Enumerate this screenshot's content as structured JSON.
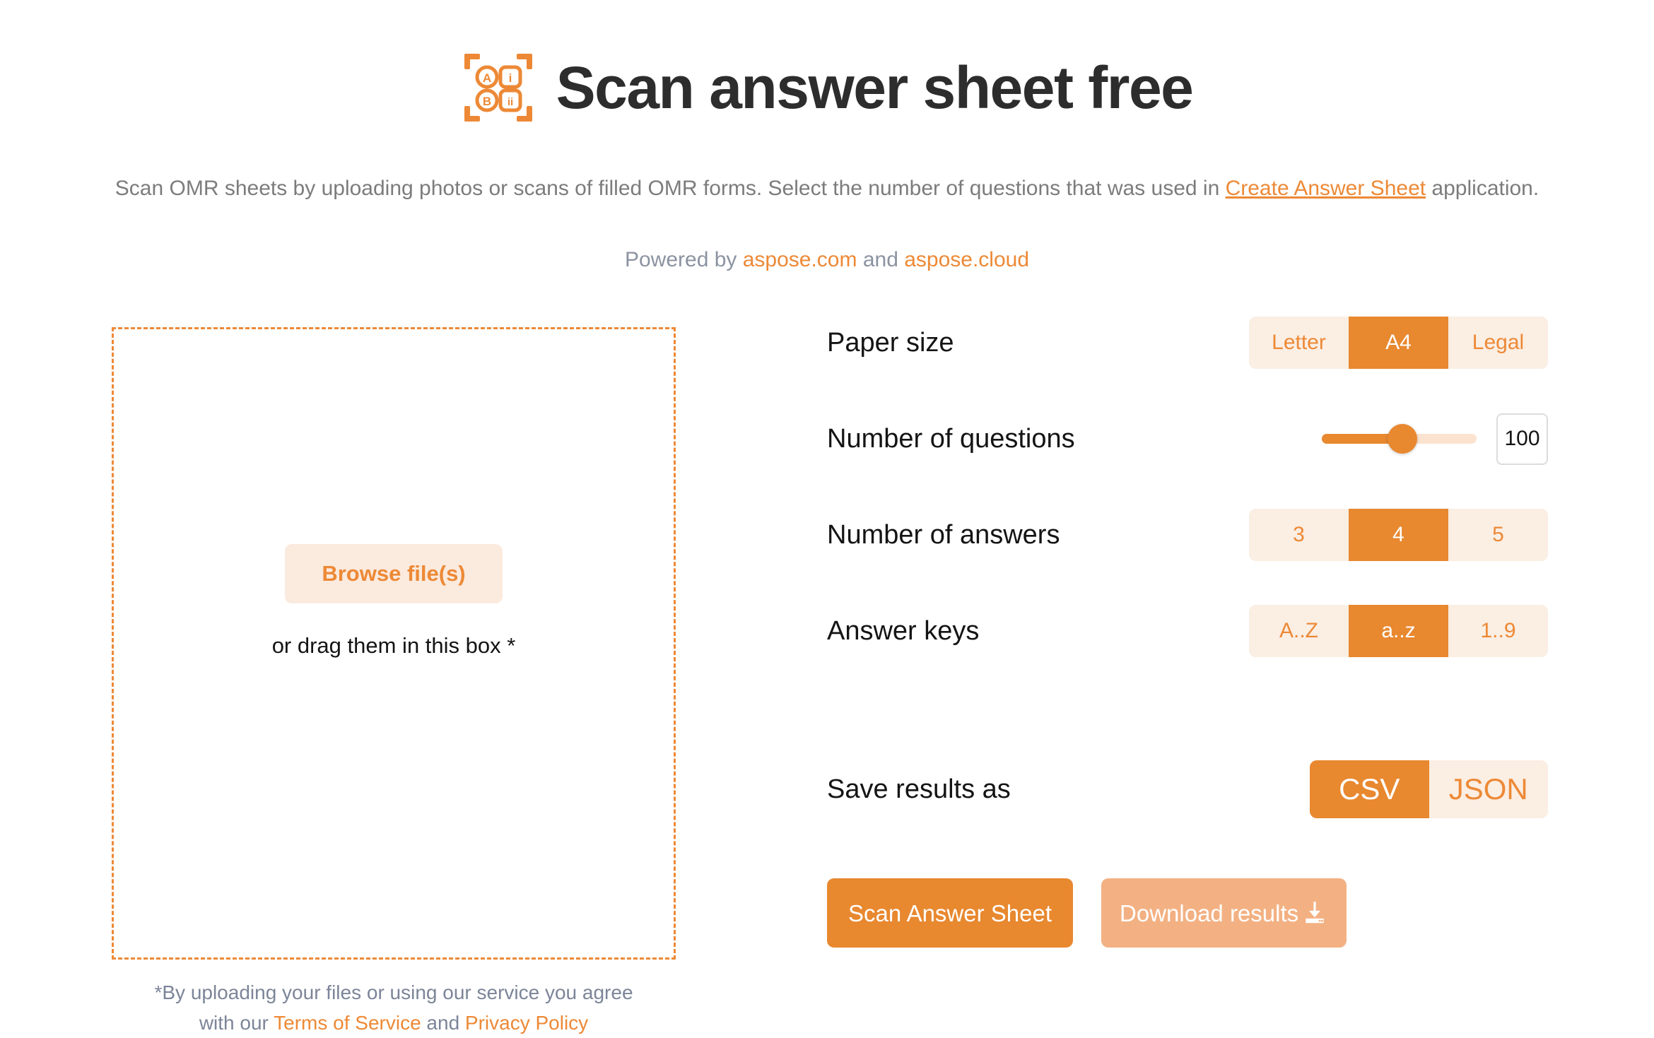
{
  "header": {
    "logo_icon": "omr-scan-icon",
    "logo_labels": [
      "A",
      "i",
      "B",
      "ii"
    ],
    "title": "Scan answer sheet free",
    "subtitle_before": "Scan OMR sheets by uploading photos or scans of filled OMR forms. Select the number of questions that was used in ",
    "subtitle_link": "Create Answer Sheet",
    "subtitle_after": " application.",
    "powered_prefix": "Powered by ",
    "powered_link1": "aspose.com",
    "powered_middle": " and ",
    "powered_link2": "aspose.cloud"
  },
  "dropzone": {
    "browse_label": "Browse file(s)",
    "drag_text": "or drag them in this box *",
    "legal_line1": "*By uploading your files or using our service you agree",
    "legal_line2_before": "with our ",
    "legal_link1": "Terms of Service",
    "legal_line2_middle": " and ",
    "legal_link2": "Privacy Policy"
  },
  "settings": {
    "paper_size": {
      "label": "Paper size",
      "options": [
        "Letter",
        "A4",
        "Legal"
      ],
      "selected": "A4"
    },
    "number_of_questions": {
      "label": "Number of questions",
      "value": "100",
      "slider_percent": 52
    },
    "number_of_answers": {
      "label": "Number of answers",
      "options": [
        "3",
        "4",
        "5"
      ],
      "selected": "4"
    },
    "answer_keys": {
      "label": "Answer keys",
      "options": [
        "A..Z",
        "a..z",
        "1..9"
      ],
      "selected": "a..z"
    },
    "save_results_as": {
      "label": "Save results as",
      "options": [
        "CSV",
        "JSON"
      ],
      "selected": "CSV"
    }
  },
  "actions": {
    "scan_label": "Scan Answer Sheet",
    "download_label": "Download results",
    "download_icon": "download-icon"
  },
  "colors": {
    "accent": "#e8882f",
    "accent_light": "#fbeee3",
    "accent_soft": "#f3b183",
    "link": "#ed8936",
    "title": "#2d2d2d",
    "muted": "#7c7c7c",
    "muted_blue": "#8b93a1"
  }
}
